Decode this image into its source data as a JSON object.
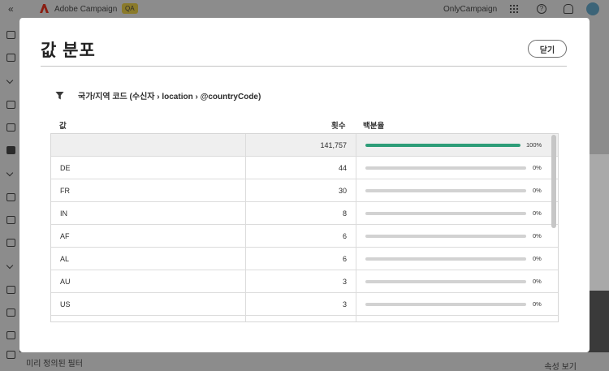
{
  "app": {
    "name": "Adobe Campaign",
    "environment_badge": "QA",
    "org_name": "OnlyCampaign",
    "bottom_left_text": "미리 정의된 필터",
    "bottom_right_text": "속성 보기"
  },
  "dialog": {
    "title": "값 분포",
    "close_label": "닫기",
    "filter_label": "국가/지역 코드 (수신자 › location › @countryCode)",
    "columns": {
      "value": "값",
      "count": "횟수",
      "percent": "백분율"
    },
    "total": {
      "value": "",
      "count": "141,757",
      "percent_text": "100%",
      "fraction": 1.0
    },
    "rows": [
      {
        "value": "DE",
        "count": "44",
        "percent_text": "0%",
        "fraction": 0.0
      },
      {
        "value": "FR",
        "count": "30",
        "percent_text": "0%",
        "fraction": 0.0
      },
      {
        "value": "IN",
        "count": "8",
        "percent_text": "0%",
        "fraction": 0.0
      },
      {
        "value": "AF",
        "count": "6",
        "percent_text": "0%",
        "fraction": 0.0
      },
      {
        "value": "AL",
        "count": "6",
        "percent_text": "0%",
        "fraction": 0.0
      },
      {
        "value": "AU",
        "count": "3",
        "percent_text": "0%",
        "fraction": 0.0
      },
      {
        "value": "US",
        "count": "3",
        "percent_text": "0%",
        "fraction": 0.0
      },
      {
        "value": "",
        "count": "",
        "percent_text": "",
        "fraction": 0.0
      }
    ]
  },
  "colors": {
    "bar_fill": "#2d9d78",
    "bar_track": "#d2d2d2",
    "overlay": "#3a3a3a"
  }
}
